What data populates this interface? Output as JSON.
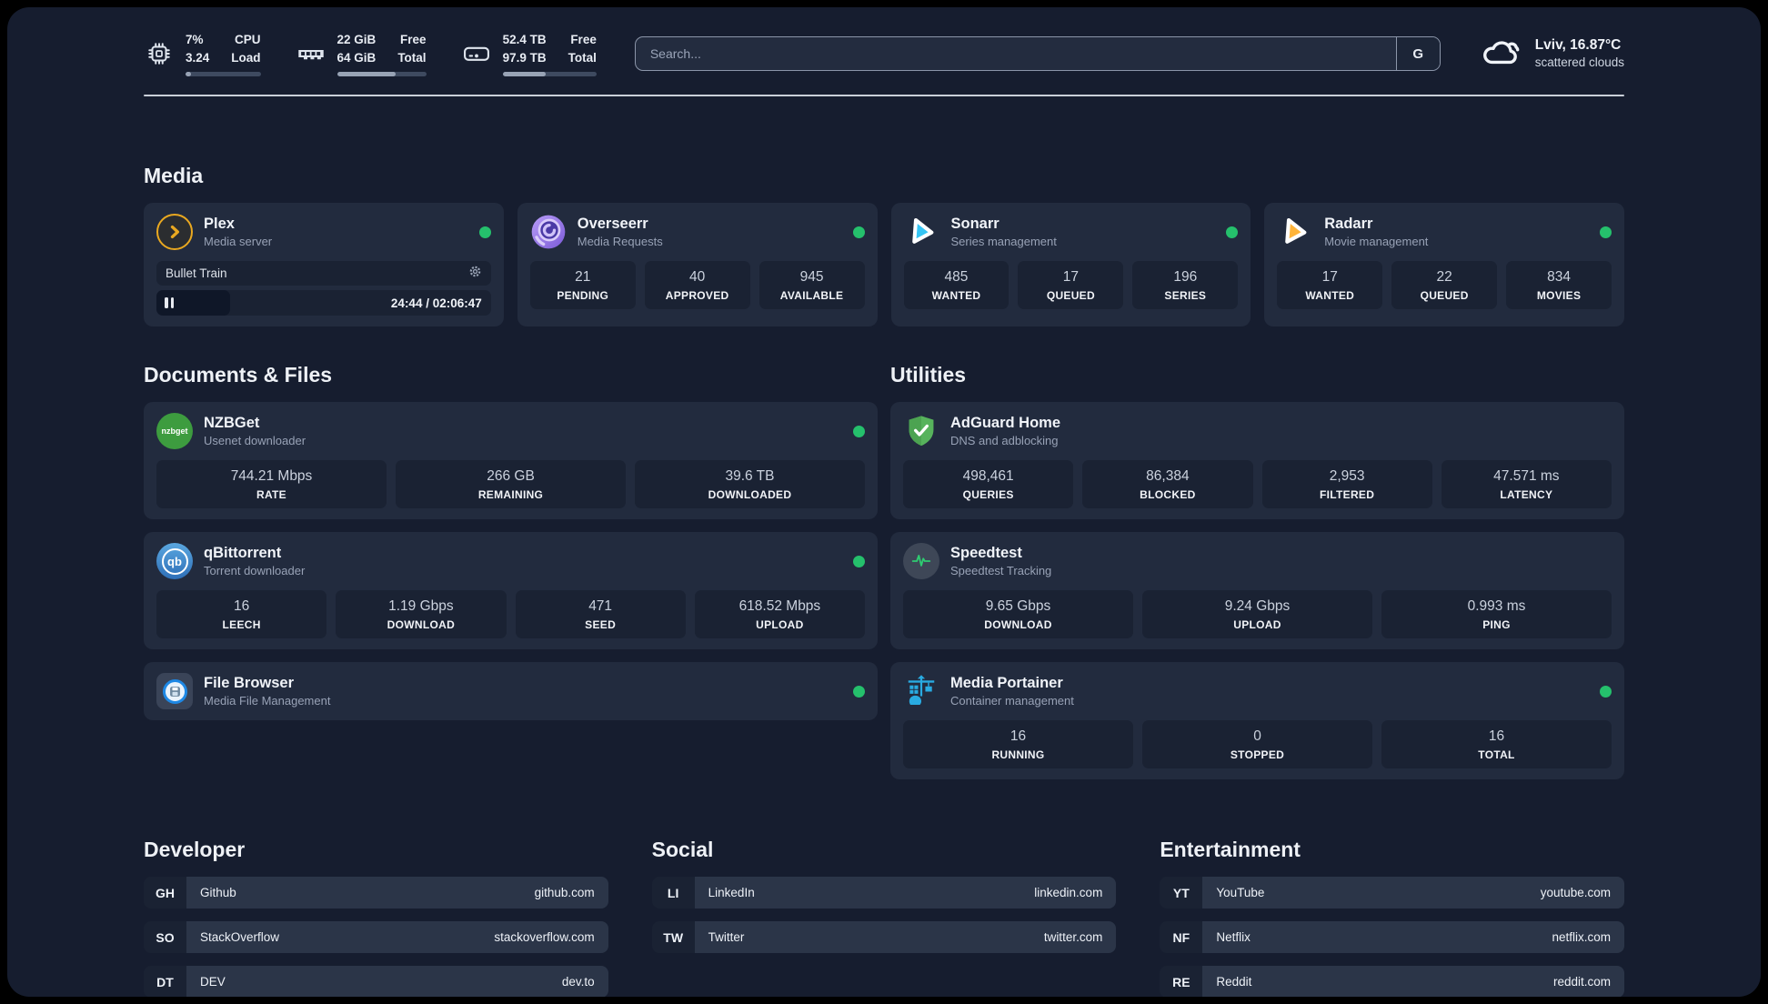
{
  "colors": {
    "status_online": "#25C06C",
    "plex_accent": "#E9A820",
    "sonarr_accent": "#35C5F4",
    "radarr_accent": "#FFB43A",
    "nzbget_accent": "#3D9C3F",
    "qbittorrent_accent": "#2E6FB8",
    "adguard_accent": "#57B35C",
    "speedtest_accent": "#2ECC71",
    "portainer_accent": "#29ABE2"
  },
  "header": {
    "cpu": {
      "value_line1": "7%",
      "value_line2": "3.24",
      "label_line1": "CPU",
      "label_line2": "Load",
      "progress_pct": 7
    },
    "memory": {
      "value_line1": "22 GiB",
      "value_line2": "64 GiB",
      "label_line1": "Free",
      "label_line2": "Total",
      "progress_pct": 66
    },
    "storage": {
      "value_line1": "52.4 TB",
      "value_line2": "97.9 TB",
      "label_line1": "Free",
      "label_line2": "Total",
      "progress_pct": 46
    },
    "search": {
      "placeholder": "Search...",
      "engine_label": "G"
    },
    "weather": {
      "location": "Lviv, 16.87°C",
      "condition": "scattered clouds"
    }
  },
  "media": {
    "section_title": "Media",
    "plex": {
      "title": "Plex",
      "subtitle": "Media server",
      "now_playing": "Bullet Train",
      "time": "24:44 / 02:06:47",
      "progress_pct": 22
    },
    "overseerr": {
      "title": "Overseerr",
      "subtitle": "Media Requests",
      "stats": [
        {
          "value": "21",
          "label": "PENDING"
        },
        {
          "value": "40",
          "label": "APPROVED"
        },
        {
          "value": "945",
          "label": "AVAILABLE"
        }
      ]
    },
    "sonarr": {
      "title": "Sonarr",
      "subtitle": "Series management",
      "stats": [
        {
          "value": "485",
          "label": "WANTED"
        },
        {
          "value": "17",
          "label": "QUEUED"
        },
        {
          "value": "196",
          "label": "SERIES"
        }
      ]
    },
    "radarr": {
      "title": "Radarr",
      "subtitle": "Movie management",
      "stats": [
        {
          "value": "17",
          "label": "WANTED"
        },
        {
          "value": "22",
          "label": "QUEUED"
        },
        {
          "value": "834",
          "label": "MOVIES"
        }
      ]
    }
  },
  "documents": {
    "section_title": "Documents & Files",
    "nzbget": {
      "title": "NZBGet",
      "subtitle": "Usenet downloader",
      "icon_text": "nzbget",
      "stats": [
        {
          "value": "744.21 Mbps",
          "label": "RATE"
        },
        {
          "value": "266 GB",
          "label": "REMAINING"
        },
        {
          "value": "39.6 TB",
          "label": "DOWNLOADED"
        }
      ]
    },
    "qbittorrent": {
      "title": "qBittorrent",
      "subtitle": "Torrent downloader",
      "icon_text": "qb",
      "stats": [
        {
          "value": "16",
          "label": "LEECH"
        },
        {
          "value": "1.19 Gbps",
          "label": "DOWNLOAD"
        },
        {
          "value": "471",
          "label": "SEED"
        },
        {
          "value": "618.52 Mbps",
          "label": "UPLOAD"
        }
      ]
    },
    "filebrowser": {
      "title": "File Browser",
      "subtitle": "Media File Management"
    }
  },
  "utilities": {
    "section_title": "Utilities",
    "adguard": {
      "title": "AdGuard Home",
      "subtitle": "DNS and adblocking",
      "stats": [
        {
          "value": "498,461",
          "label": "QUERIES"
        },
        {
          "value": "86,384",
          "label": "BLOCKED"
        },
        {
          "value": "2,953",
          "label": "FILTERED"
        },
        {
          "value": "47.571 ms",
          "label": "LATENCY"
        }
      ]
    },
    "speedtest": {
      "title": "Speedtest",
      "subtitle": "Speedtest Tracking",
      "stats": [
        {
          "value": "9.65 Gbps",
          "label": "DOWNLOAD"
        },
        {
          "value": "9.24 Gbps",
          "label": "UPLOAD"
        },
        {
          "value": "0.993 ms",
          "label": "PING"
        }
      ]
    },
    "portainer": {
      "title": "Media Portainer",
      "subtitle": "Container management",
      "stats": [
        {
          "value": "16",
          "label": "RUNNING"
        },
        {
          "value": "0",
          "label": "STOPPED"
        },
        {
          "value": "16",
          "label": "TOTAL"
        }
      ]
    }
  },
  "bookmarks": {
    "developer": {
      "section_title": "Developer",
      "items": [
        {
          "abbr": "GH",
          "name": "Github",
          "url": "github.com"
        },
        {
          "abbr": "SO",
          "name": "StackOverflow",
          "url": "stackoverflow.com"
        },
        {
          "abbr": "DT",
          "name": "DEV",
          "url": "dev.to"
        }
      ]
    },
    "social": {
      "section_title": "Social",
      "items": [
        {
          "abbr": "LI",
          "name": "LinkedIn",
          "url": "linkedin.com"
        },
        {
          "abbr": "TW",
          "name": "Twitter",
          "url": "twitter.com"
        }
      ]
    },
    "entertainment": {
      "section_title": "Entertainment",
      "items": [
        {
          "abbr": "YT",
          "name": "YouTube",
          "url": "youtube.com"
        },
        {
          "abbr": "NF",
          "name": "Netflix",
          "url": "netflix.com"
        },
        {
          "abbr": "RE",
          "name": "Reddit",
          "url": "reddit.com"
        }
      ]
    }
  }
}
